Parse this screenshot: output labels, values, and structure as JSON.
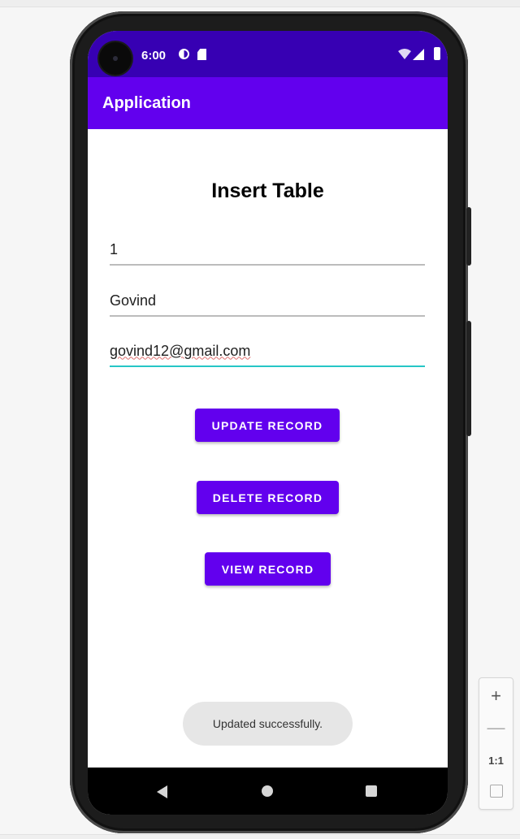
{
  "status_bar": {
    "time": "6:00",
    "icons": [
      "sync-icon",
      "sd-card-icon",
      "wifi-icon",
      "signal-icon",
      "battery-icon"
    ]
  },
  "app_bar": {
    "title": "Application"
  },
  "form": {
    "heading": "Insert Table",
    "id_value": "1",
    "name_value": "Govind",
    "email_value": "govind12@gmail.com"
  },
  "buttons": {
    "update": "UPDATE RECORD",
    "delete": "DELETE RECORD",
    "view": "VIEW RECORD"
  },
  "toast": {
    "message": "Updated successfully."
  },
  "emulator_zoom": {
    "zoom_in": "+",
    "zoom_out": "—",
    "actual_size": "1:1"
  },
  "colors": {
    "status_bar": "#3700b3",
    "app_bar": "#6200ee",
    "button": "#6200ee",
    "focused_underline": "#26c6c6"
  }
}
